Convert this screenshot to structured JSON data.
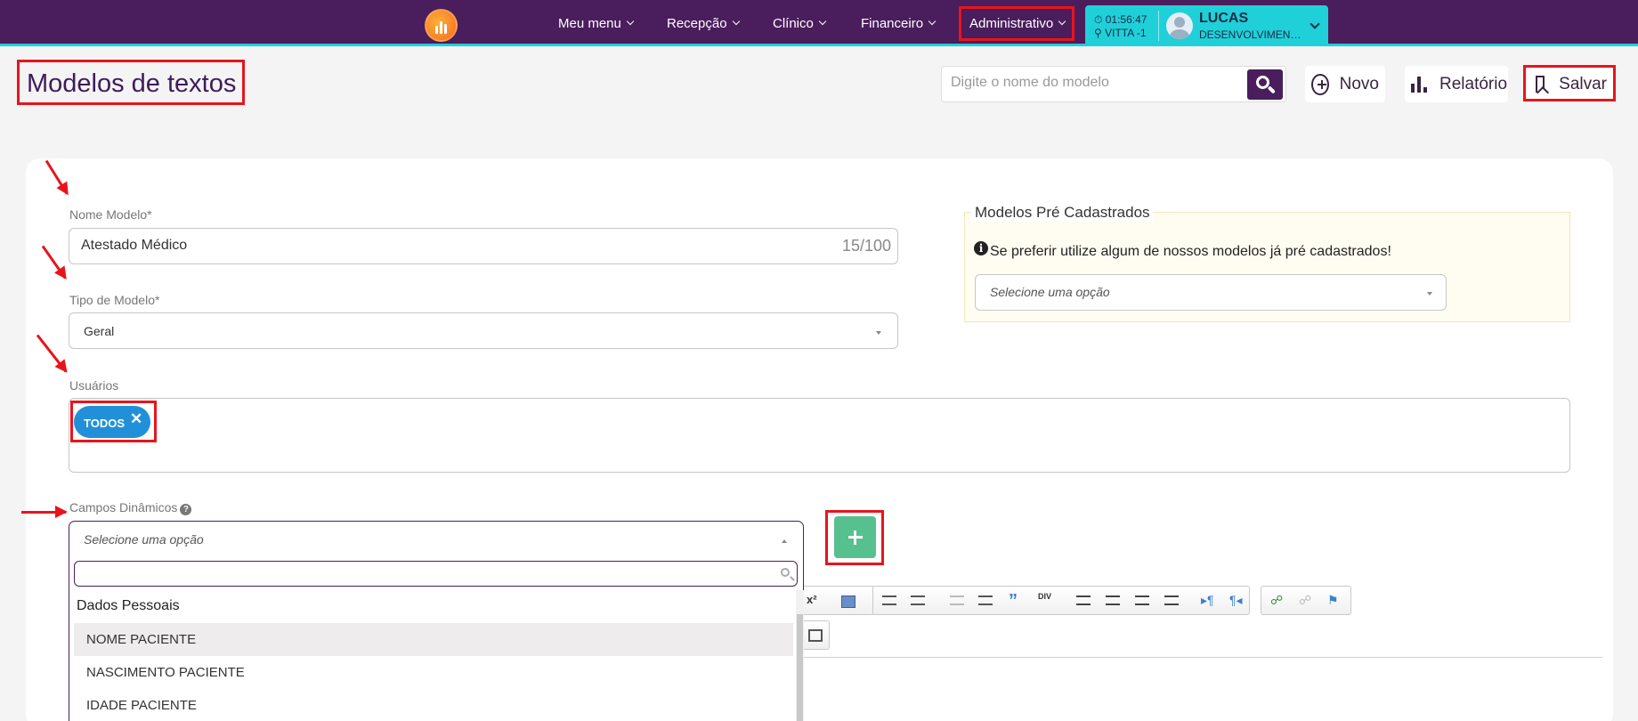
{
  "topbar": {
    "menu": [
      {
        "label": "Meu menu"
      },
      {
        "label": "Recepção"
      },
      {
        "label": "Clínico"
      },
      {
        "label": "Financeiro"
      },
      {
        "label": "Administrativo"
      }
    ],
    "clock": "01:56:47",
    "location": "VITTA -1",
    "user_name": "LUCAS",
    "user_role": "DESENVOLVIMENTO"
  },
  "header": {
    "title": "Modelos de textos",
    "search_placeholder": "Digite o nome do modelo",
    "new_label": "Novo",
    "report_label": "Relatório",
    "save_label": "Salvar"
  },
  "form": {
    "nome_label": "Nome Modelo*",
    "nome_value": "Atestado Médico",
    "nome_counter": "15/100",
    "tipo_label": "Tipo de Modelo*",
    "tipo_value": "Geral",
    "usuarios_label": "Usuários",
    "usuarios_tag": "TODOS",
    "campos_label": "Campos Dinâmicos",
    "campos_placeholder": "Selecione uma opção"
  },
  "pre": {
    "title": "Modelos Pré Cadastrados",
    "hint": "Se preferir utilize algum de nossos modelos já pré cadastrados!",
    "placeholder": "Selecione uma opção"
  },
  "dropdown": {
    "group": "Dados Pessoais",
    "options": [
      "NOME PACIENTE",
      "NASCIMENTO PACIENTE",
      "IDADE PACIENTE"
    ],
    "highlighted_option": "NOME PACIENTE"
  },
  "colors": {
    "topbar": "#4a1d5c",
    "accent": "#1fd0d8",
    "annotation": "#e8141c",
    "add_button": "#57c08f",
    "tag": "#2290d8"
  },
  "icons": [
    "chevron-down-icon",
    "clock-icon",
    "location-icon",
    "avatar",
    "search-icon",
    "plus-circle-icon",
    "bar-chart-icon",
    "bookmark-icon",
    "info-icon",
    "help-icon",
    "close-icon",
    "plus-icon"
  ]
}
